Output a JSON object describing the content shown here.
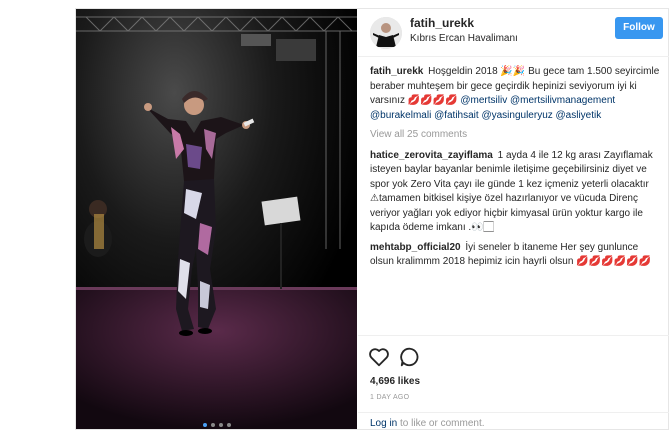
{
  "author": {
    "username": "fatih_urekk",
    "location": "Kıbrıs Ercan Havalimanı",
    "follow_label": "Follow"
  },
  "caption": {
    "username": "fatih_urekk",
    "text": "Hoşgeldin 2018 🎉🎉 Bu gece tam 1.500 seyircimle beraber muhteşem bir gece geçirdik hepinizi seviyorum iyi ki varsınız 💋💋💋💋",
    "mentions": "@mertsiliv @mertsilivmanagement @burakelmali @fatihsait @yasinguleryuz @asliyetik"
  },
  "view_all_label": "View all 25 comments",
  "comments": [
    {
      "username": "hatice_zerovita_zayiflama",
      "text": "1 ayda 4 ile 12 kg arası Zayıflamak isteyen baylar bayanlar benimle iletişime geçebilirsiniz diyet ve spor yok Zero Vita çayı ile günde 1 kez içmeniz yeterli olacaktır ⚠tamamen bitkisel kişiye özel hazırlanıyor ve vücuda Direnç veriyor yağları yok ediyor hiçbir kimyasal ürün yoktur kargo ile kapıda ödeme imkanı .👀🏻"
    },
    {
      "username": "mehtabp_official20",
      "text": "İyi seneler b itaneme Her şey gunlunce olsun kralimmm 2018 hepimiz icin hayrli olsun 💋💋💋💋💋💋"
    }
  ],
  "likes": "4,696 likes",
  "time_ago": "1 DAY AGO",
  "login": {
    "link": "Log in",
    "rest": " to like or comment."
  },
  "icons": {
    "like": "heart-icon",
    "comment": "comment-bubble-icon"
  },
  "colors": {
    "follow_button": "#3897f0",
    "link": "#003569",
    "muted": "#999999"
  }
}
